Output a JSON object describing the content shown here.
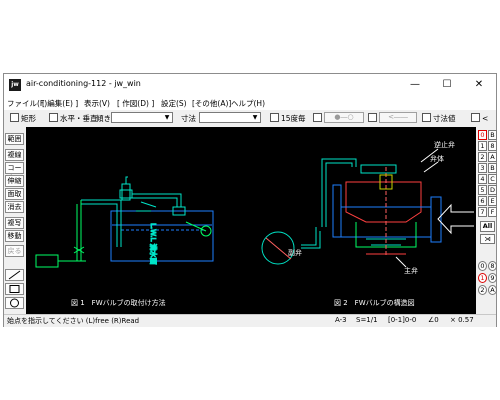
{
  "window": {
    "title": "air-conditioning-112 - jw_win",
    "app_icon_text": "jw",
    "controls": [
      "—",
      "☐",
      "✕"
    ]
  },
  "menu": [
    "ファイル(F)",
    "[ 編集(E) ]",
    "表示(V)",
    "[ 作図(D) ]",
    "設定(S)",
    "[その他(A)]",
    "ヘルプ(H)"
  ],
  "toolbar": {
    "rect_label": "矩形",
    "hv_label": "水平・垂直",
    "slope_label": "傾き",
    "dim_label": "寸法",
    "deg15_label": "15度毎",
    "arrow_btn1": "●―○",
    "arrow_btn2": "<――",
    "dim_value_label": "寸法値",
    "lt_label": "<"
  },
  "left_tools": [
    "範囲",
    "複線",
    "コーナー",
    "伸縮",
    "面取",
    "消去",
    "複写",
    "移動",
    "戻る"
  ],
  "left_bottom_icons": [
    "line-tool-icon",
    "rectangle-tool-icon",
    "circle-tool-icon"
  ],
  "right_tools": {
    "letters": [
      "0",
      "B",
      "1",
      "2",
      "3",
      "4",
      "5",
      "6",
      "7",
      "8",
      "9"
    ],
    "letters_col2": [
      "B",
      "8",
      "A",
      "B",
      "C",
      "D",
      "E",
      "F"
    ],
    "all_label": "All",
    "bottom": [
      "0",
      "8",
      "1",
      "9",
      "2",
      "A"
    ]
  },
  "drawing": {
    "fig1_caption": "図 1　FWバルブの取付け方法",
    "fig2_caption": "図 2　FWバルブの構造図",
    "label_stop_valve": "逆止弁",
    "label_float": "弁体",
    "label_main_valve": "主弁",
    "label_sub_valve": "副弁",
    "label_water_level": "L.W.L 満水面"
  },
  "status": {
    "prompt": "始点を指示してください (L)free (R)Read",
    "paper": "A-3",
    "scale": "S=1/1",
    "layer": "[0-1]0-0",
    "angle": "∠0",
    "zoom": "× 0.57"
  }
}
